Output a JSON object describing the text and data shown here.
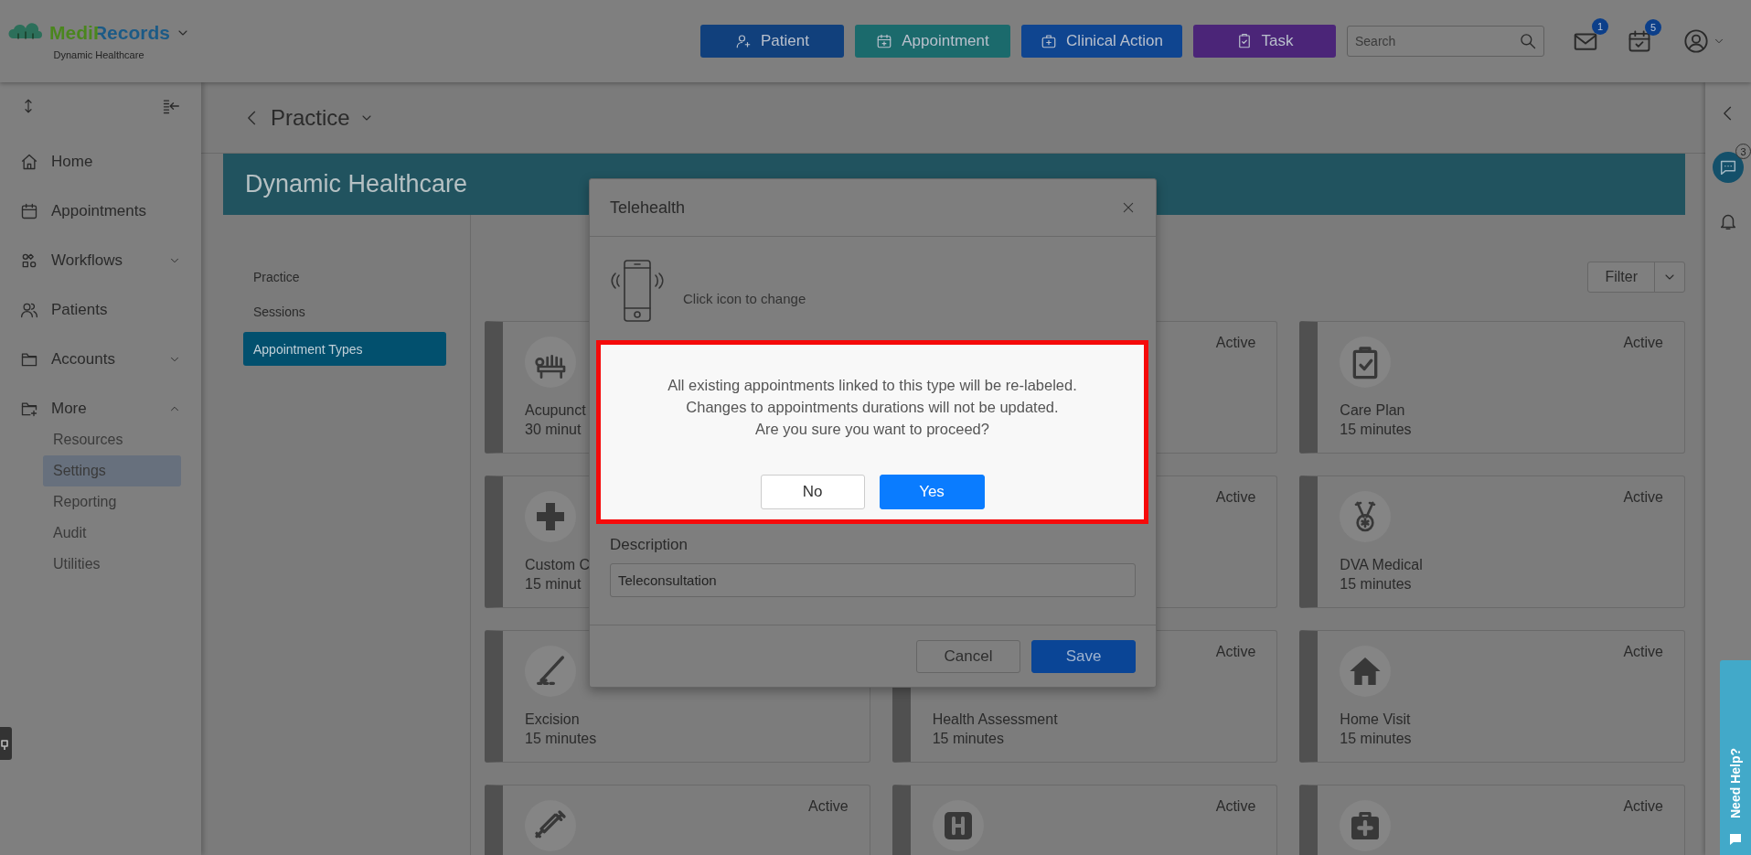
{
  "header": {
    "brand": "MediRecords",
    "subtitle": "Dynamic Healthcare",
    "actions": [
      {
        "label": "Patient",
        "color": "#11407c"
      },
      {
        "label": "Appointment",
        "color": "#1b6a6c"
      },
      {
        "label": "Clinical Action",
        "color": "#0f4590"
      },
      {
        "label": "Task",
        "color": "#4b2578"
      }
    ],
    "search": {
      "placeholder": "Search"
    },
    "mail_badge": "1",
    "tasks_badge": "5"
  },
  "sidebar": {
    "items": [
      {
        "label": "Home",
        "kind": "link"
      },
      {
        "label": "Appointments",
        "kind": "link"
      },
      {
        "label": "Workflows",
        "kind": "group",
        "expanded": false
      },
      {
        "label": "Patients",
        "kind": "link"
      },
      {
        "label": "Accounts",
        "kind": "group",
        "expanded": false
      },
      {
        "label": "More",
        "kind": "group",
        "expanded": true,
        "children": [
          {
            "label": "Resources",
            "selected": false
          },
          {
            "label": "Settings",
            "selected": true
          },
          {
            "label": "Reporting",
            "selected": false
          },
          {
            "label": "Audit",
            "selected": false
          },
          {
            "label": "Utilities",
            "selected": false
          }
        ]
      }
    ]
  },
  "page": {
    "title": "Practice",
    "banner": "Dynamic Healthcare",
    "subnav": [
      {
        "label": "Practice",
        "selected": false
      },
      {
        "label": "Sessions",
        "selected": false
      },
      {
        "label": "Appointment Types",
        "selected": true
      }
    ],
    "filter": "Filter",
    "cards": [
      {
        "name": "Acupunct",
        "duration": "30 minut"
      },
      {
        "status": "Active"
      },
      {
        "name": "Care Plan",
        "duration": "15 minutes",
        "status": "Active"
      },
      {
        "name": "Custom C",
        "duration": "15 minut"
      },
      {
        "status": "Active"
      },
      {
        "name": "DVA Medical",
        "duration": "15 minutes",
        "status": "Active"
      },
      {
        "name": "Excision",
        "duration": "15 minutes"
      },
      {
        "name": "Health Assessment",
        "duration": "15 minutes",
        "status": "Active"
      },
      {
        "name": "Home Visit",
        "duration": "15 minutes",
        "status": "Active"
      },
      {
        "status": "Active"
      },
      {
        "status": "Active"
      },
      {
        "status": "Active"
      }
    ]
  },
  "modal": {
    "title": "Telehealth",
    "hint": "Click icon to change",
    "description_label": "Description",
    "description": "Teleconsultation",
    "buttons": [
      {
        "label": "Cancel",
        "kind": "secondary"
      },
      {
        "label": "Save",
        "kind": "primary"
      }
    ]
  },
  "confirm": {
    "highlighted": true,
    "lines": [
      "All existing appointments linked to this type will be re-labeled.",
      "Changes to appointments durations will not be updated.",
      "Are you sure you want to proceed?"
    ],
    "buttons": [
      {
        "label": "No",
        "kind": "secondary"
      },
      {
        "label": "Yes",
        "kind": "primary"
      }
    ]
  },
  "rail": {
    "chat_badge": "3",
    "help": "Need Help?"
  }
}
